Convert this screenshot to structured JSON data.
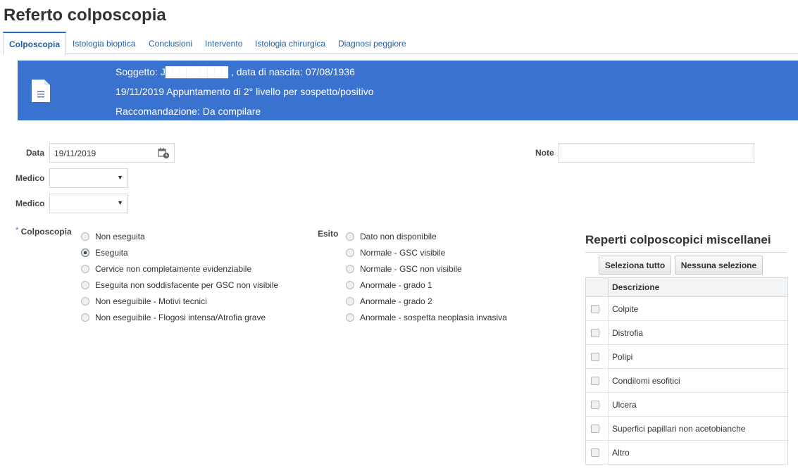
{
  "page": {
    "title": "Referto colposcopia"
  },
  "tabs": [
    {
      "label": "Colposcopia",
      "active": true
    },
    {
      "label": "Istologia bioptica"
    },
    {
      "label": "Conclusioni"
    },
    {
      "label": "Intervento"
    },
    {
      "label": "Istologia chirurgica"
    },
    {
      "label": "Diagnosi peggiore"
    }
  ],
  "banner": {
    "icon": "document-icon",
    "subject": "Soggetto: J█████████ , data di nascita: 07/08/1936",
    "appointment": "19/11/2019 Appuntamento di 2° livello per sospetto/positivo",
    "recommendation": "Raccomandazione: Da compilare",
    "color": "#3a73cf"
  },
  "form": {
    "date_label": "Data",
    "date_value": "19/11/2019",
    "calendar_icon": "calendar-icon",
    "medico1_label": "Medico",
    "medico1_value": "",
    "medico2_label": "Medico",
    "medico2_value": "",
    "note_label": "Note",
    "note_value": ""
  },
  "colposcopia": {
    "required_mark": "*",
    "label": "Colposcopia",
    "options": [
      "Non eseguita",
      "Eseguita",
      "Cervice non completamente evidenziabile",
      "Eseguita non soddisfacente per GSC non visibile",
      "Non eseguibile - Motivi tecnici",
      "Non eseguibile - Flogosi intensa/Atrofia grave"
    ],
    "selected_index": 1
  },
  "esito": {
    "label": "Esito",
    "options": [
      "Dato non disponibile",
      "Normale - GSC visibile",
      "Normale - GSC non visibile",
      "Anormale - grado 1",
      "Anormale - grado 2",
      "Anormale - sospetta neoplasia invasiva"
    ]
  },
  "reperti": {
    "title": "Reperti colposcopici miscellanei",
    "select_all": "Seleziona tutto",
    "select_none": "Nessuna selezione",
    "column_header": "Descrizione",
    "rows": [
      "Colpite",
      "Distrofia",
      "Polipi",
      "Condilomi esofitici",
      "Ulcera",
      "Superfici papillari non acetobianche",
      "Altro"
    ]
  }
}
